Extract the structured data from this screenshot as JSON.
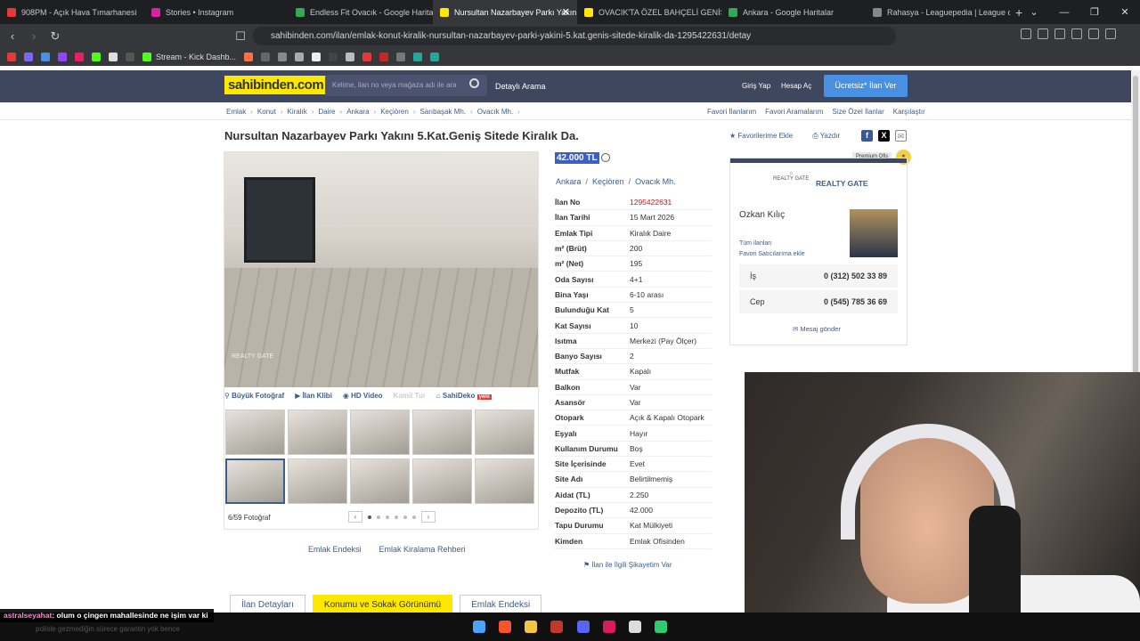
{
  "browser": {
    "tabs": [
      {
        "label": "908PM - Açık Hava Tımarhanesi",
        "color": "#e53935"
      },
      {
        "label": "Stories • Instagram",
        "color": "#d6249f"
      },
      {
        "label": "Endless Fit Ovacık - Google Haritalar",
        "color": "#34a853"
      },
      {
        "label": "Nursultan Nazarbayev Parkı Yakın",
        "color": "#ffe800",
        "active": true
      },
      {
        "label": "OVACIK'TA ÖZEL BAHÇELİ GENİŞ FER",
        "color": "#ffe800"
      },
      {
        "label": "Ankara - Google Haritalar",
        "color": "#34a853"
      },
      {
        "label": "Rahasya - Leaguepedia | League of L",
        "color": "#888888"
      }
    ],
    "url": "sahibinden.com/ilan/emlak-konut-kiralik-nursultan-nazarbayev-parki-yakini-5.kat.genis-sitede-kiralik-da-1295422631/detay",
    "bookmark_label": "Stream - Kick Dashb..."
  },
  "site": {
    "logo": "sahibinden.com",
    "search_placeholder": "Kelime, ilan no veya mağaza adı ile ara",
    "detayli": "Detaylı Arama",
    "giris": "Giriş Yap",
    "hesap": "Hesap Aç",
    "ilan_ver": "Ücretsiz* İlan Ver"
  },
  "breadcrumbs": [
    "Emlak",
    "Konut",
    "Kiralık",
    "Daire",
    "Ankara",
    "Keçiören",
    "Sarıbaşak Mh.",
    "Ovacık Mh."
  ],
  "toplinks": [
    "Favori İlanlarım",
    "Favori Aramalarım",
    "Size Özel İlanlar",
    "Karşılaştır"
  ],
  "listing": {
    "title": "Nursultan Nazarbayev Parkı Yakını 5.Kat.Geniş Sitede Kiralık Da.",
    "fav": "Favorilerime Ekle",
    "print": "Yazdır",
    "price": "42.000 TL",
    "location": [
      "Ankara",
      "Keçiören",
      "Ovacık Mh."
    ],
    "details": [
      {
        "k": "İlan No",
        "v": "1295422631",
        "red": true
      },
      {
        "k": "İlan Tarihi",
        "v": "15 Mart 2026"
      },
      {
        "k": "Emlak Tipi",
        "v": "Kiralık Daire"
      },
      {
        "k": "m² (Brüt)",
        "v": "200"
      },
      {
        "k": "m² (Net)",
        "v": "195"
      },
      {
        "k": "Oda Sayısı",
        "v": "4+1"
      },
      {
        "k": "Bina Yaşı",
        "v": "6-10 arası"
      },
      {
        "k": "Bulunduğu Kat",
        "v": "5"
      },
      {
        "k": "Kat Sayısı",
        "v": "10"
      },
      {
        "k": "Isıtma",
        "v": "Merkezi (Pay Ölçer)"
      },
      {
        "k": "Banyo Sayısı",
        "v": "2"
      },
      {
        "k": "Mutfak",
        "v": "Kapalı"
      },
      {
        "k": "Balkon",
        "v": "Var"
      },
      {
        "k": "Asansör",
        "v": "Var"
      },
      {
        "k": "Otopark",
        "v": "Açık & Kapalı Otopark"
      },
      {
        "k": "Eşyalı",
        "v": "Hayır"
      },
      {
        "k": "Kullanım Durumu",
        "v": "Boş"
      },
      {
        "k": "Site İçerisinde",
        "v": "Evet"
      },
      {
        "k": "Site Adı",
        "v": "Belirtilmemiş"
      },
      {
        "k": "Aidat (TL)",
        "v": "2.250"
      },
      {
        "k": "Depozito (TL)",
        "v": "42.000"
      },
      {
        "k": "Tapu Durumu",
        "v": "Kat Mülkiyeti"
      },
      {
        "k": "Kimden",
        "v": "Emlak Ofisinden"
      }
    ],
    "sikayet": "İlan ile İlgili Şikayetim Var"
  },
  "gallery": {
    "watermark": "REALTY GATE",
    "media": [
      "Büyük Fotoğraf",
      "İlan Klibi",
      "HD Video",
      "Kamil Tur",
      "SahiDeko"
    ],
    "new_badge": "yeni",
    "counter": "6/59 Fotoğraf",
    "links": [
      "Emlak Endeksi",
      "Emlak Kiralama Rehberi"
    ]
  },
  "seller": {
    "premium": "Premium Ofis",
    "logo_text": "REALTY GATE",
    "name_company": "REALTY GATE",
    "agent": "Ozkan Kılıç",
    "all_listings": "Tüm ilanları",
    "fav_seller": "Favori Satıcılarıma ekle",
    "phones": [
      {
        "k": "İş",
        "v": "0 (312) 502 33 89"
      },
      {
        "k": "Cep",
        "v": "0 (545) 785 36 69"
      }
    ],
    "message": "Mesaj gönder"
  },
  "bottom_tabs": [
    "İlan Detayları",
    "Konumu ve Sokak Görünümü",
    "Emlak Endeksi"
  ],
  "chat": {
    "user": "astralseyahat",
    "message": ": olum o çingen mahallesinde ne işim var ki",
    "message2": "polisle gezmediğin sürece garantin yok bence"
  }
}
